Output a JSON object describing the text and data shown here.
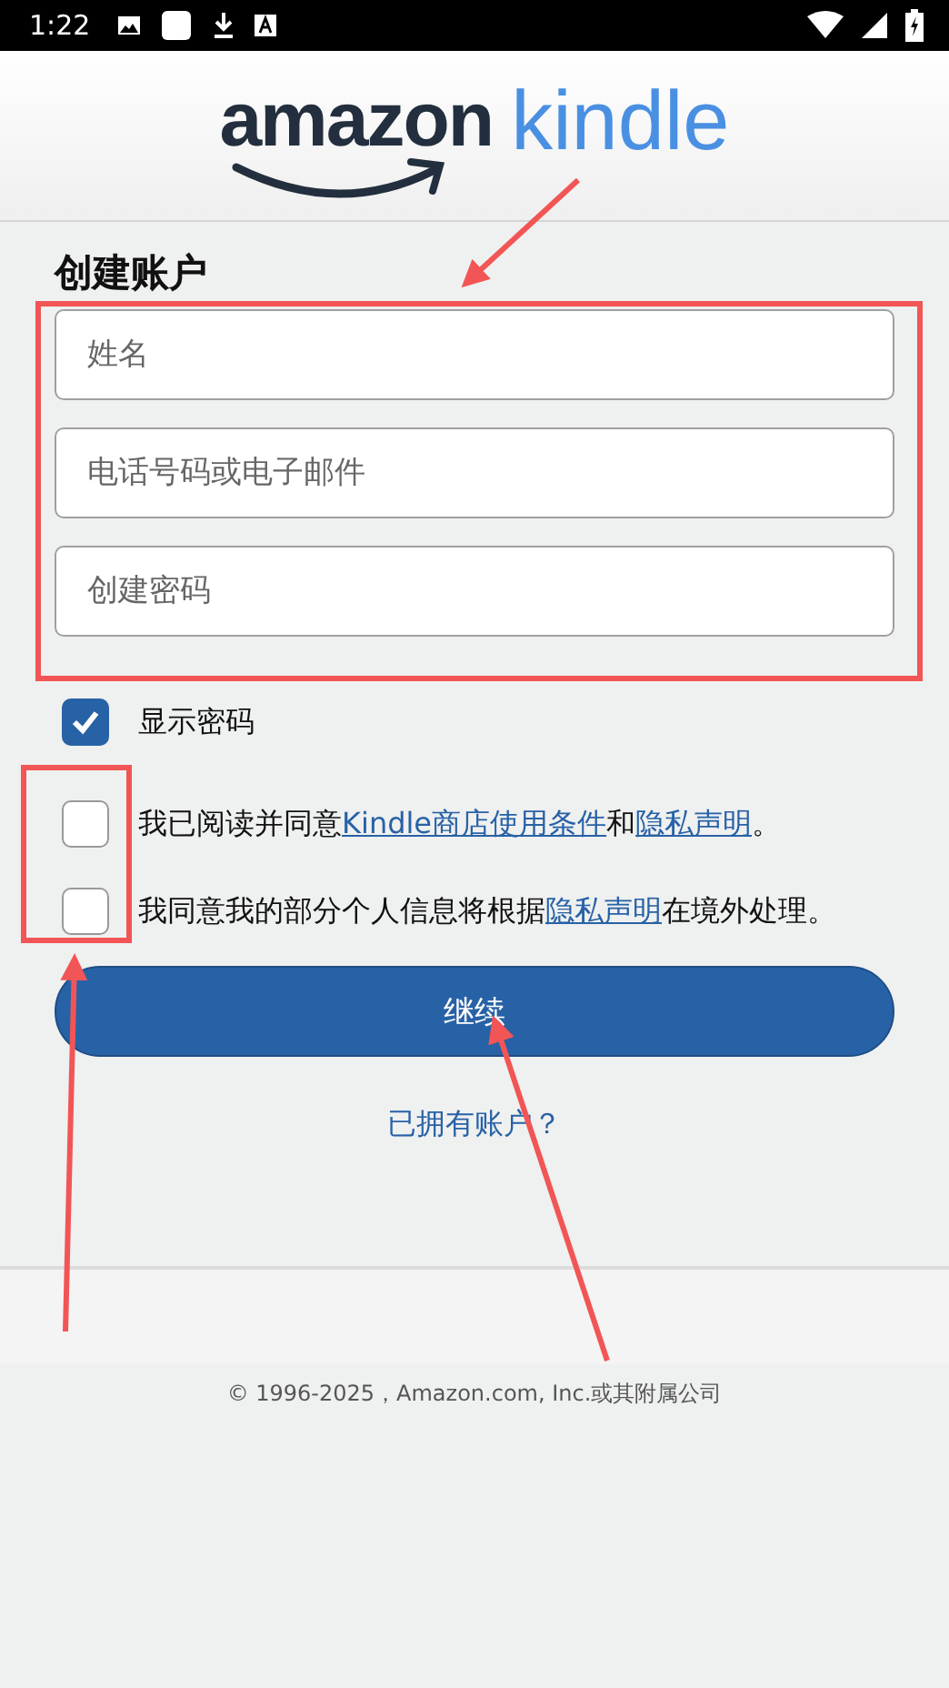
{
  "status_bar": {
    "time": "1:22"
  },
  "logo": {
    "brand": "amazon",
    "product": "kindle"
  },
  "form": {
    "title": "创建账户",
    "fields": [
      {
        "placeholder": "姓名"
      },
      {
        "placeholder": "电话号码或电子邮件"
      },
      {
        "placeholder": "创建密码"
      }
    ],
    "show_password": {
      "label": "显示密码",
      "checked": true
    },
    "agreements": [
      {
        "checked": false,
        "parts": [
          {
            "text": "我已阅读并同意",
            "link": false
          },
          {
            "text": "Kindle商店使用条件",
            "link": true
          },
          {
            "text": "和",
            "link": false
          },
          {
            "text": "隐私声明",
            "link": true
          },
          {
            "text": "。",
            "link": false
          }
        ]
      },
      {
        "checked": false,
        "parts": [
          {
            "text": "我同意我的部分个人信息将根据",
            "link": false
          },
          {
            "text": "隐私声明",
            "link": true
          },
          {
            "text": "在境外处理。",
            "link": false
          }
        ]
      }
    ],
    "continue_button": "继续",
    "signin_link": "已拥有账户？"
  },
  "footer": {
    "copyright": "© 1996-2025，Amazon.com, Inc.或其附属公司"
  }
}
